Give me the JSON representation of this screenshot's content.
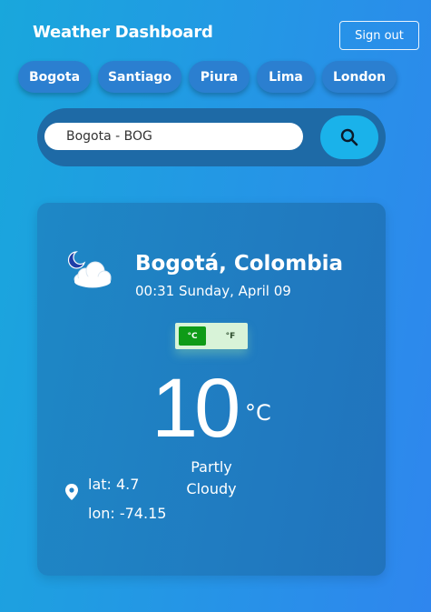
{
  "header": {
    "title": "Weather Dashboard",
    "sign_out_label": "Sign out"
  },
  "cities": [
    {
      "label": "Bogota"
    },
    {
      "label": "Santiago"
    },
    {
      "label": "Piura"
    },
    {
      "label": "Lima"
    },
    {
      "label": "London"
    }
  ],
  "search": {
    "value": "Bogota - BOG",
    "button_icon": "search-icon"
  },
  "weather": {
    "location": "Bogotá, Colombia",
    "datetime": "00:31 Sunday, April 09",
    "icon": "partly-cloudy-night-icon",
    "unit_celsius_label": "°C",
    "unit_fahrenheit_label": "°F",
    "selected_unit": "°C",
    "temperature": "10",
    "temperature_unit": "°C",
    "condition": "Partly Cloudy",
    "lat": "lat: 4.7",
    "lon": "lon: -74.15"
  },
  "colors": {
    "background_start": "#19a7dc",
    "background_end": "#2f86ee",
    "search_button": "#1ab2ea",
    "active_unit": "#0e9b17"
  }
}
